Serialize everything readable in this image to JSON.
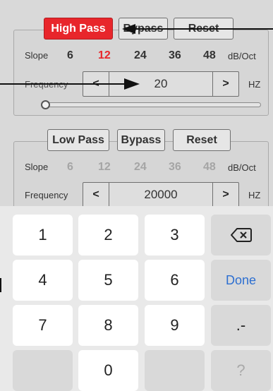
{
  "high_pass": {
    "mode_label": "High Pass",
    "bypass_label": "Bypass",
    "reset_label": "Reset",
    "slope_label": "Slope",
    "slopes": [
      "6",
      "12",
      "24",
      "36",
      "48"
    ],
    "slope_unit": "dB/Oct",
    "frequency_label": "Frequency",
    "frequency_value": "20",
    "frequency_unit": "HZ",
    "decrement_symbol": "<",
    "increment_symbol": ">",
    "slider_level": 0.0
  },
  "low_pass": {
    "mode_label": "Low Pass",
    "bypass_label": "Bypass",
    "reset_label": "Reset",
    "slope_label": "Slope",
    "slopes": [
      "6",
      "12",
      "24",
      "36",
      "48"
    ],
    "slope_unit": "dB/Oct",
    "frequency_label": "Frequency",
    "frequency_value": "20000",
    "frequency_unit": "HZ",
    "decrement_symbol": "<",
    "increment_symbol": ">"
  },
  "keyboard": {
    "keys": [
      "1",
      "2",
      "3",
      "4",
      "5",
      "6",
      "7",
      "8",
      "9",
      "0"
    ],
    "done_label": "Done",
    "punct_label": ".-",
    "unknown_label": "?"
  },
  "colors": {
    "active": "#e8262b",
    "panel_bg": "#d6d6d6",
    "done_blue": "#2d6fd1"
  }
}
